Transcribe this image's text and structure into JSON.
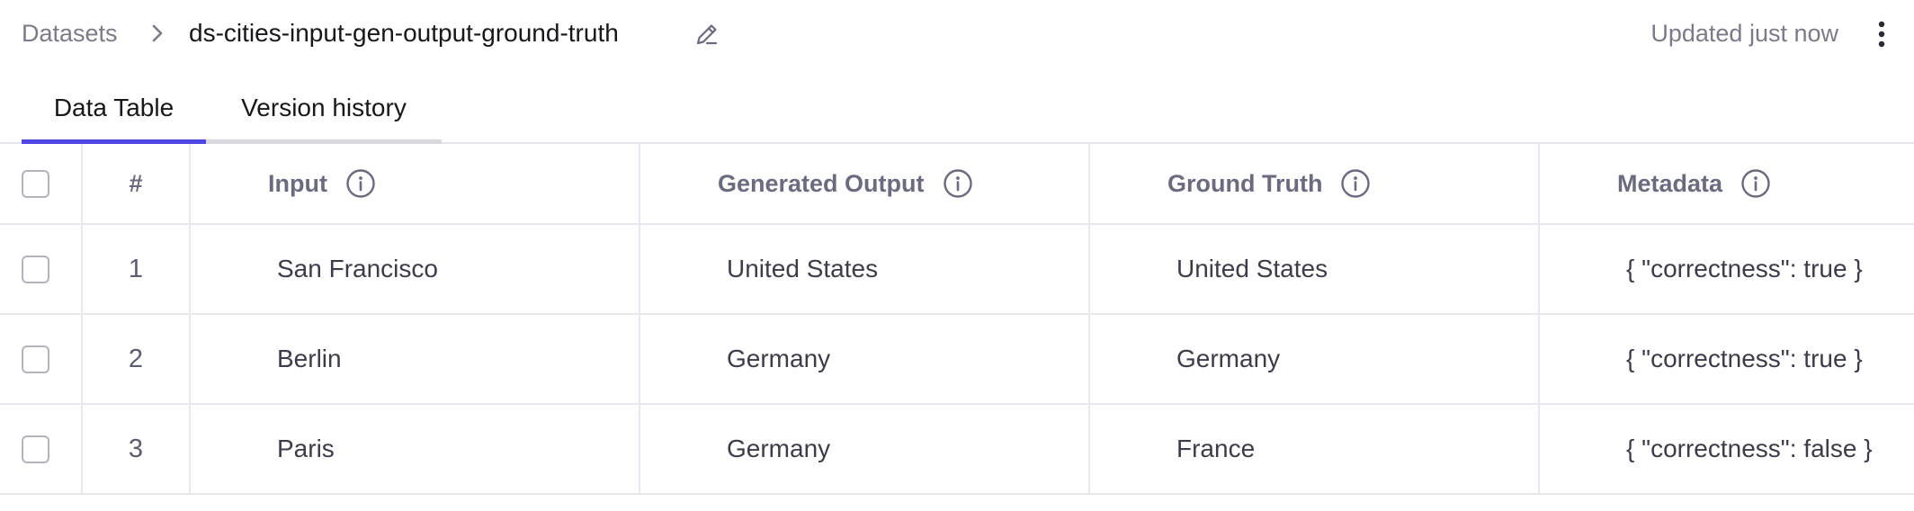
{
  "breadcrumb": {
    "parent": "Datasets",
    "current": "ds-cities-input-gen-output-ground-truth"
  },
  "header": {
    "updated": "Updated just now"
  },
  "tabs": [
    {
      "label": "Data Table",
      "active": true
    },
    {
      "label": "Version history",
      "active": false
    }
  ],
  "table": {
    "columns": {
      "num": "#",
      "input": "Input",
      "generated_output": "Generated Output",
      "ground_truth": "Ground Truth",
      "metadata": "Metadata"
    },
    "rows": [
      {
        "num": "1",
        "input": "San Francisco",
        "generated_output": "United States",
        "ground_truth": "United States",
        "metadata": "{ \"correctness\": true }"
      },
      {
        "num": "2",
        "input": "Berlin",
        "generated_output": "Germany",
        "ground_truth": "Germany",
        "metadata": "{ \"correctness\": true }"
      },
      {
        "num": "3",
        "input": "Paris",
        "generated_output": "Germany",
        "ground_truth": "France",
        "metadata": "{ \"correctness\": false }"
      }
    ]
  },
  "colors": {
    "accent": "#4f46e5",
    "muted_text": "#7b7b88",
    "header_text": "#6b6b80",
    "border": "#e8e8ee"
  },
  "icons": {
    "separator": "chevron-right-icon",
    "edit": "pencil-icon",
    "more": "more-vertical-icon",
    "info": "info-icon"
  }
}
